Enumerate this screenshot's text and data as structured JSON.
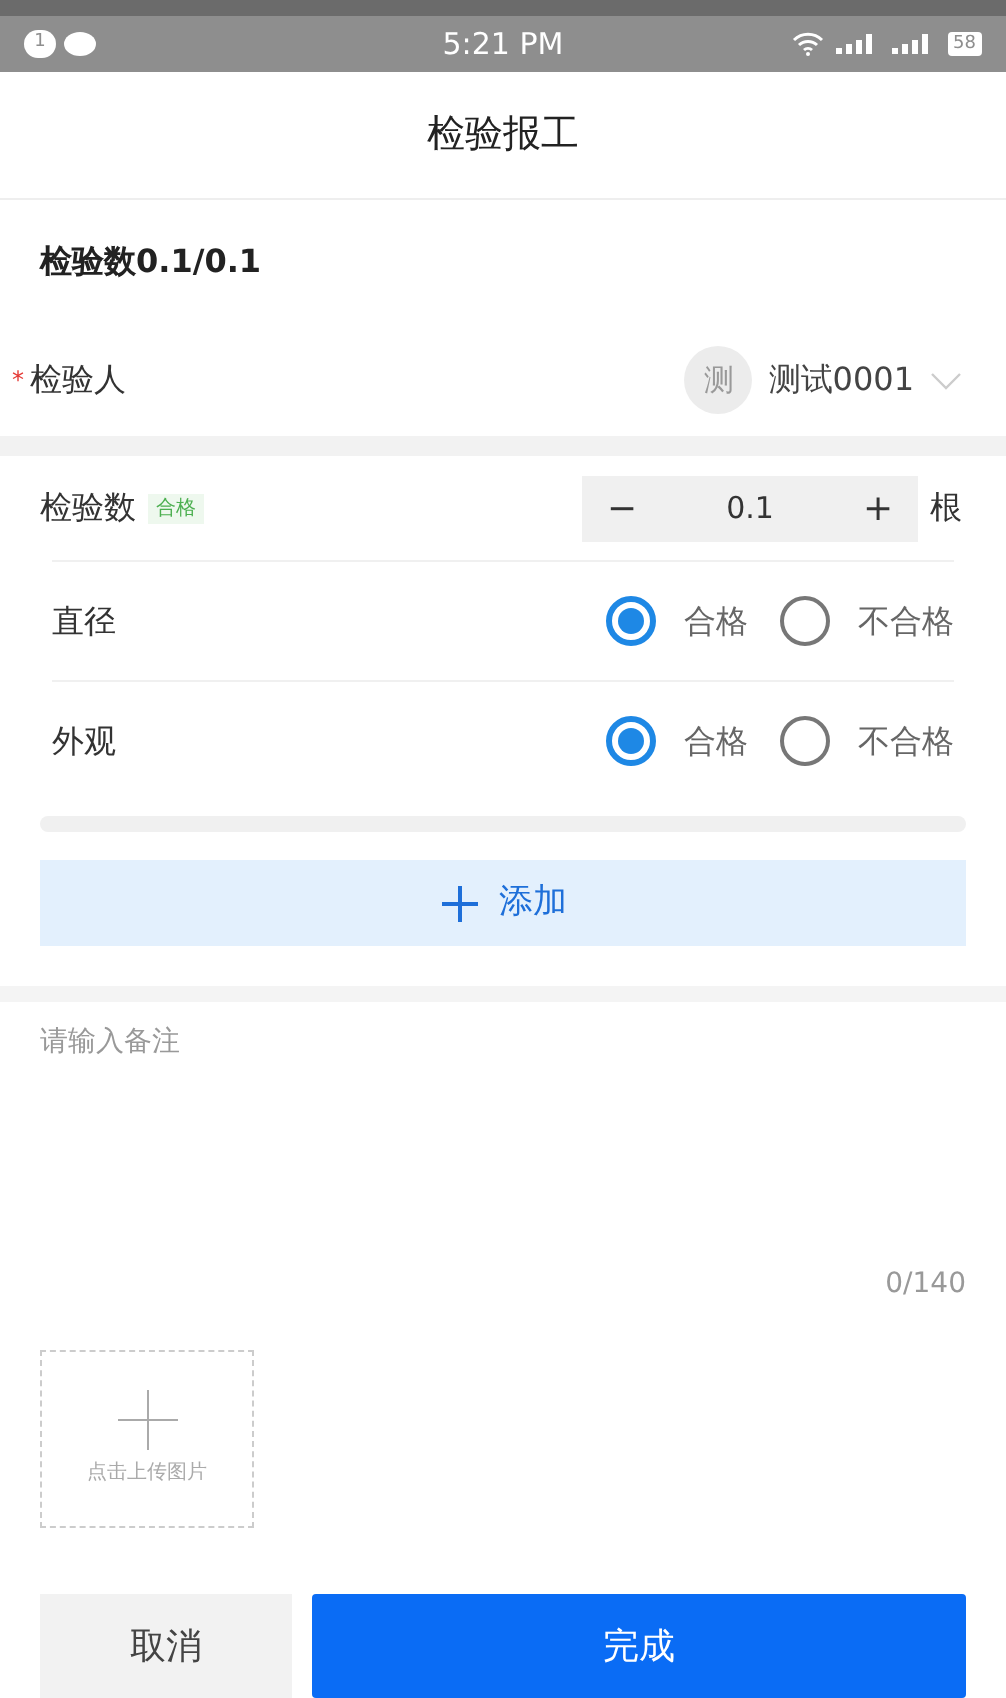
{
  "status_bar": {
    "badge": "1",
    "time": "5:21 PM",
    "battery": "58"
  },
  "header": {
    "title": "检验报工"
  },
  "summary": {
    "title": "检验数0.1/0.1"
  },
  "inspector": {
    "label": "检验人",
    "required": true,
    "required_mark": "*",
    "avatar": "测",
    "value": "测试0001"
  },
  "quantity": {
    "label": "检验数",
    "tag": "合格",
    "minus": "−",
    "value": "0.1",
    "plus": "+",
    "unit": "根"
  },
  "items": [
    {
      "name": "直径",
      "options": [
        {
          "label": "合格",
          "selected": true
        },
        {
          "label": "不合格",
          "selected": false
        }
      ]
    },
    {
      "name": "外观",
      "options": [
        {
          "label": "合格",
          "selected": true
        },
        {
          "label": "不合格",
          "selected": false
        }
      ]
    }
  ],
  "add_button": {
    "label": "添加"
  },
  "remarks": {
    "placeholder": "请输入备注",
    "counter": "0/140"
  },
  "upload": {
    "label": "点击上传图片"
  },
  "buttons": {
    "cancel": "取消",
    "done": "完成"
  }
}
